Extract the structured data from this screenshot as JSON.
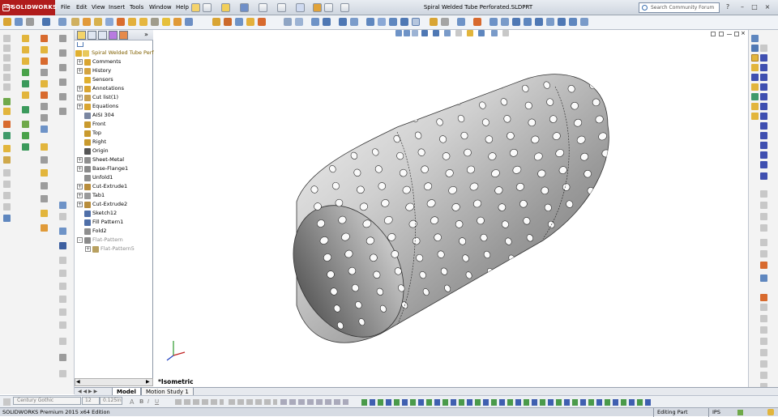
{
  "app": {
    "logo_text": "SOLIDWORKS",
    "document_title": "Spiral Welded Tube Perforated.SLDPRT",
    "menus": [
      "File",
      "Edit",
      "View",
      "Insert",
      "Tools",
      "Window",
      "Help"
    ],
    "search_placeholder": "Search Community Forum"
  },
  "feature_tree": {
    "root": "Spiral Welded Tube Perforated",
    "items": [
      {
        "label": "Comments",
        "expand": "+",
        "icon": "comments-icon",
        "color": "#d9a531",
        "indent": 1
      },
      {
        "label": "History",
        "expand": "+",
        "icon": "history-icon",
        "color": "#d4a441",
        "indent": 1
      },
      {
        "label": "Sensors",
        "expand": "",
        "icon": "sensors-icon",
        "color": "#e0b030",
        "indent": 1
      },
      {
        "label": "Annotations",
        "expand": "+",
        "icon": "annotations-icon",
        "color": "#d9a531",
        "indent": 1
      },
      {
        "label": "Cut list(1)",
        "expand": "+",
        "icon": "cut-list-icon",
        "color": "#c8a050",
        "indent": 1
      },
      {
        "label": "Equations",
        "expand": "+",
        "icon": "equations-icon",
        "color": "#d9a531",
        "indent": 1
      },
      {
        "label": "AISI 304",
        "expand": "",
        "icon": "material-icon",
        "color": "#7a86a0",
        "indent": 1
      },
      {
        "label": "Front",
        "expand": "",
        "icon": "plane-icon",
        "color": "#c99a2e",
        "indent": 1
      },
      {
        "label": "Top",
        "expand": "",
        "icon": "plane-icon",
        "color": "#c99a2e",
        "indent": 1
      },
      {
        "label": "Right",
        "expand": "",
        "icon": "plane-icon",
        "color": "#c99a2e",
        "indent": 1
      },
      {
        "label": "Origin",
        "expand": "",
        "icon": "origin-icon",
        "color": "#555555",
        "indent": 1
      },
      {
        "label": "Sheet-Metal",
        "expand": "+",
        "icon": "sheet-metal-icon",
        "color": "#8f8f8f",
        "indent": 1
      },
      {
        "label": "Base-Flange1",
        "expand": "+",
        "icon": "base-flange-icon",
        "color": "#8a8a8a",
        "indent": 1
      },
      {
        "label": "Unfold1",
        "expand": "",
        "icon": "unfold-icon",
        "color": "#8f8f8f",
        "indent": 1
      },
      {
        "label": "Cut-Extrude1",
        "expand": "+",
        "icon": "cut-extrude-icon",
        "color": "#b88d3c",
        "indent": 1
      },
      {
        "label": "Tab1",
        "expand": "+",
        "icon": "tab-feature-icon",
        "color": "#9a9a9a",
        "indent": 1
      },
      {
        "label": "Cut-Extrude2",
        "expand": "+",
        "icon": "cut-extrude-icon",
        "color": "#b88d3c",
        "indent": 1
      },
      {
        "label": "Sketch12",
        "expand": "",
        "icon": "sketch-icon",
        "color": "#4f6fa8",
        "indent": 1
      },
      {
        "label": "Fill Pattern1",
        "expand": "",
        "icon": "fill-pattern-icon",
        "color": "#4f6fa8",
        "indent": 1
      },
      {
        "label": "Fold2",
        "expand": "",
        "icon": "fold-icon",
        "color": "#8f8f8f",
        "indent": 1
      },
      {
        "label": "Flat-Pattern",
        "expand": "-",
        "icon": "flat-pattern-icon",
        "color": "#8a8a8a",
        "indent": 1,
        "grey": true
      },
      {
        "label": "Flat-Pattern5",
        "expand": "+",
        "icon": "flat-pattern-icon",
        "color": "#b8a060",
        "indent": 2,
        "grey": true
      }
    ]
  },
  "viewport": {
    "view_label": "*Isometric"
  },
  "bottom_tabs": [
    "Model",
    "Motion Study 1"
  ],
  "format_bar": {
    "font": "Century Gothic",
    "size": "12",
    "line": "0.125in"
  },
  "status": {
    "app_edition": "SOLIDWORKS Premium 2015 x64 Edition",
    "mode": "Editing Part",
    "units": "IPS"
  }
}
